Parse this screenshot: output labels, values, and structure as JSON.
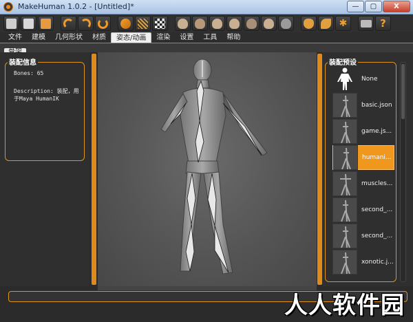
{
  "window": {
    "title": "MakeHuman 1.0.2 - [Untitled]*",
    "minimize_label": "—",
    "maximize_label": "▢",
    "close_label": "X"
  },
  "toolbar": {
    "buttons": [
      "folder-icon",
      "save-icon",
      "export-icon",
      "undo-icon",
      "redo-icon",
      "reset-icon",
      "smooth-icon",
      "wireframe-icon",
      "checker-icon",
      "front-view-icon",
      "back-view-icon",
      "left-view-icon",
      "right-view-icon",
      "top-view-icon",
      "bottom-view-icon",
      "reset-camera-icon",
      "symmetry-icon",
      "symmetry-right-icon",
      "symmetry-left-icon",
      "pose-icon",
      "screenshot-icon",
      "help-icon"
    ]
  },
  "menu": {
    "tabs": [
      "文件",
      "建模",
      "几何形状",
      "材质",
      "姿态/动画",
      "渲染",
      "设置",
      "工具",
      "帮助"
    ],
    "active_index": 4
  },
  "subtabs": {
    "active": "骨架"
  },
  "left_panel": {
    "title": "装配信息",
    "bones": "Bones: 65",
    "description_1": "Description: 装配，用",
    "description_2": "于Maya HumanIK"
  },
  "right_panel": {
    "title": "装配预设",
    "presets": [
      {
        "label": "None"
      },
      {
        "label": "basic.json"
      },
      {
        "label": "game.js..."
      },
      {
        "label": "humani..."
      },
      {
        "label": "muscles..."
      },
      {
        "label": "second_..."
      },
      {
        "label": "second_..."
      },
      {
        "label": "xonotic.j..."
      }
    ],
    "selected_index": 3
  },
  "watermark": "人人软件园",
  "colors": {
    "accent": "#e0941e",
    "selected": "#f0981e",
    "background": "#2b2b2b"
  }
}
